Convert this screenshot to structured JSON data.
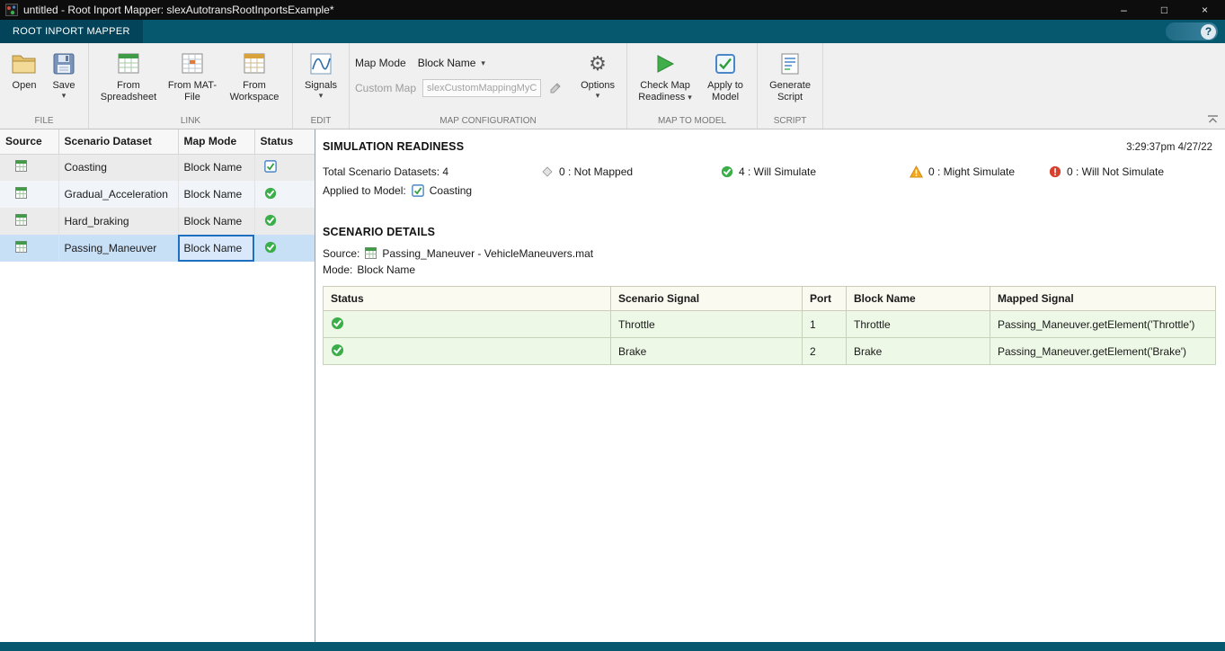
{
  "window": {
    "title": "untitled - Root Inport Mapper: slexAutotransRootInportsExample*",
    "minimize_glyph": "–",
    "maximize_glyph": "□",
    "close_glyph": "×"
  },
  "tabbar": {
    "tab_label": "ROOT INPORT MAPPER",
    "help_glyph": "?"
  },
  "icons": {
    "dropdown_arrow": "▾",
    "gear": "⚙"
  },
  "ribbon": {
    "file": {
      "label": "FILE",
      "open": "Open",
      "save": "Save"
    },
    "link": {
      "label": "LINK",
      "spreadsheet": "From Spreadsheet",
      "matfile": "From MAT-File",
      "workspace": "From Workspace"
    },
    "edit": {
      "label": "EDIT",
      "signals": "Signals"
    },
    "map_configuration": {
      "label": "MAP CONFIGURATION",
      "map_mode_label": "Map Mode",
      "map_mode_value": "Block Name",
      "custom_map_label": "Custom Map",
      "custom_map_value": "slexCustomMappingMyCu",
      "options": "Options"
    },
    "map_to_model": {
      "label": "MAP TO MODEL",
      "check": "Check Map Readiness",
      "apply": "Apply to Model"
    },
    "script": {
      "label": "SCRIPT",
      "generate": "Generate Script"
    }
  },
  "scenario_table": {
    "headers": [
      "Source",
      "Scenario Dataset",
      "Map Mode",
      "Status"
    ],
    "rows": [
      {
        "dataset": "Coasting",
        "map_mode": "Block Name",
        "status": "applied"
      },
      {
        "dataset": "Gradual_Acceleration",
        "map_mode": "Block Name",
        "status": "will-simulate"
      },
      {
        "dataset": "Hard_braking",
        "map_mode": "Block Name",
        "status": "will-simulate"
      },
      {
        "dataset": "Passing_Maneuver",
        "map_mode": "Block Name",
        "status": "will-simulate",
        "selected": true
      }
    ]
  },
  "simulation_readiness": {
    "title": "SIMULATION READINESS",
    "timestamp": "3:29:37pm 4/27/22",
    "total": "Total Scenario Datasets: 4",
    "stats": [
      {
        "icon": "not-mapped",
        "text": "0 : Not Mapped"
      },
      {
        "icon": "will-simulate",
        "text": "4 : Will Simulate"
      },
      {
        "icon": "might-simulate",
        "text": "0 : Might Simulate"
      },
      {
        "icon": "will-not-simulate",
        "text": "0 : Will Not Simulate"
      }
    ],
    "applied_label": "Applied to Model:",
    "applied_value": "Coasting"
  },
  "scenario_details": {
    "title": "SCENARIO DETAILS",
    "source_label": "Source:",
    "source_value": "Passing_Maneuver - VehicleManeuvers.mat",
    "mode_label": "Mode:",
    "mode_value": "Block Name",
    "table": {
      "headers": [
        "Status",
        "Scenario Signal",
        "Port",
        "Block Name",
        "Mapped Signal"
      ],
      "rows": [
        {
          "signal": "Throttle",
          "port": "1",
          "block_name": "Throttle",
          "mapped_signal": "Passing_Maneuver.getElement('Throttle')"
        },
        {
          "signal": "Brake",
          "port": "2",
          "block_name": "Brake",
          "mapped_signal": "Passing_Maneuver.getElement('Brake')"
        }
      ]
    }
  },
  "colors": {
    "toolstrip": "#06586f",
    "selection": "#c8e0f6",
    "focus_border": "#1f6fc0",
    "status_green": "#3aae49",
    "warning_orange": "#f3a81d",
    "error_red": "#d6402f",
    "applied_blue": "#4a86c8",
    "detail_row_green": "#edf8e6"
  }
}
